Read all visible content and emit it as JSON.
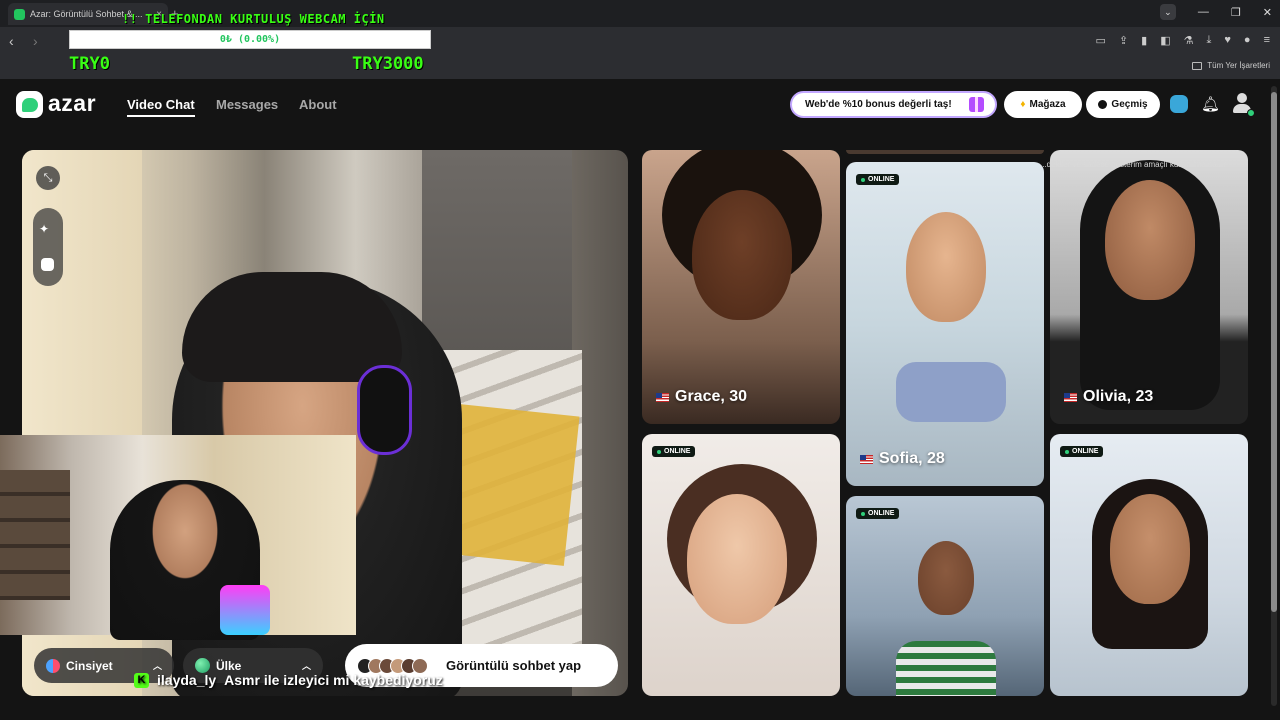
{
  "browser": {
    "tab_title": "Azar: Görüntülü Sohbet & ...",
    "tab_close": "×",
    "new_tab": "+",
    "bookmarks_all": "Tüm Yer İşaretleri"
  },
  "overlay": {
    "title": "!! TELEFONDAN KURTULUŞ WEBCAM İÇİN",
    "progress_text": "0₺ (0.00%)",
    "progress_fraction": 0.0,
    "goal_min": "TRY0",
    "goal_max": "TRY3000"
  },
  "site": {
    "logo": "azar",
    "nav": {
      "video_chat": "Video Chat",
      "messages": "Messages",
      "about": "About"
    },
    "bonus_label": "Web'de %10 bonus değerli taş!",
    "store_label": "Mağaza",
    "history_label": "Geçmiş"
  },
  "controls": {
    "gender_label": "Cinsiyet",
    "country_label": "Ülke",
    "start_label": "Görüntülü sohbet yap"
  },
  "stream_chat": {
    "platform_badge": "K",
    "username": "ilayda_ly",
    "message": "Asmr ile izleyici mi kaybediyoruz"
  },
  "profiles": [
    {
      "name": "Grace, 30",
      "online": false
    },
    {
      "name": "Sofia, 28",
      "online": true
    },
    {
      "name": "Olivia, 23",
      "online": false
    },
    {
      "name": "",
      "online": true
    },
    {
      "name": "",
      "online": true
    },
    {
      "name": "",
      "online": true
    }
  ],
  "badge_online": "ONLINE",
  "disclaimer": "...dekiler ve sadece gösterim amaçlı kullanılmaktadır"
}
